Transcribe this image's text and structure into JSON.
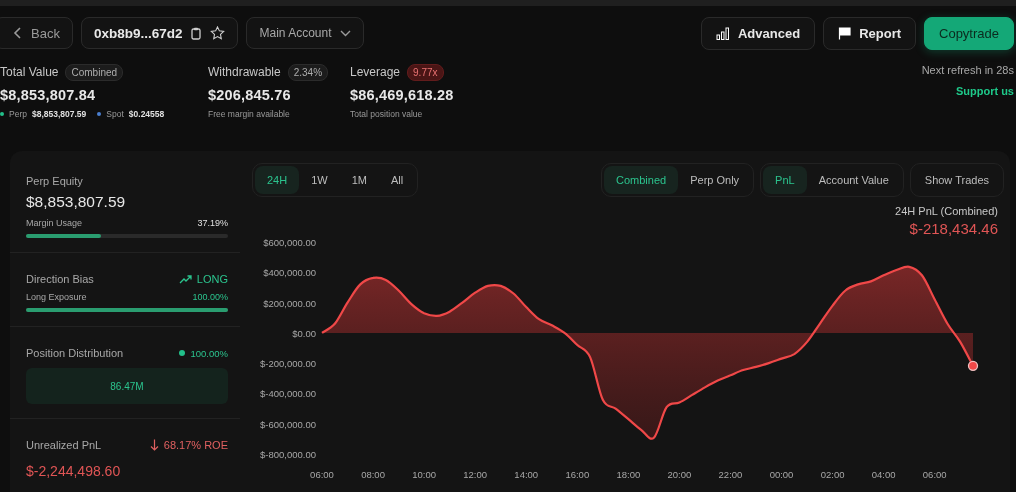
{
  "header": {
    "back_button": "Back",
    "address": "0xb8b9...67d2",
    "account_select": "Main Account",
    "buttons": [
      {
        "label": "Advanced",
        "kind": "advanced"
      },
      {
        "label": "Report",
        "kind": "report"
      },
      {
        "label": "Copytrade",
        "kind": "primary"
      }
    ]
  },
  "stats": [
    {
      "label": "Total Value",
      "badge": "Combined",
      "color": "#1c1c1c",
      "value": "$8,853,807.84",
      "breakdown": [
        {
          "label": "Perp",
          "value": "$8,853,807.59",
          "color": "#22c08a"
        },
        {
          "label": "Spot",
          "value": "$0.24558",
          "color": "#4a7fd0"
        }
      ]
    },
    {
      "label": "Withdrawable",
      "badge": "2.34%",
      "color": "#1c1c1c",
      "value": "$206,845.76",
      "note": "Free margin available"
    },
    {
      "label": "Leverage",
      "badge": "9.77x",
      "color": "#4a1515",
      "value": "$86,469,618.28",
      "note": "Total position value"
    }
  ],
  "refresh": "Next refresh in 28s",
  "support_link": "Support us",
  "panel": {
    "perp_equity": {
      "label": "Perp Equity",
      "value": "$8,853,807.59",
      "meter": {
        "label": "Margin Usage",
        "reading": "37.19%",
        "level": 0.37
      }
    },
    "direction_bias": {
      "label": "Direction Bias",
      "value": "LONG",
      "meter": {
        "label": "Long Exposure",
        "reading": "100.00%",
        "level": 1
      }
    },
    "position_distribution": {
      "label": "Position Distribution",
      "reading": "100.00%",
      "color": "#22c08a",
      "bar_label": "86.47M"
    },
    "unrealized_pnl": {
      "label": "Unrealized PnL",
      "change": "68.17% ROE",
      "value": "$-2,244,498.60"
    }
  },
  "toolbar": {
    "ranges": [
      {
        "label": "24H",
        "selected": true
      },
      {
        "label": "1W",
        "selected": false
      },
      {
        "label": "1M",
        "selected": false
      },
      {
        "label": "All",
        "selected": false
      }
    ],
    "modes": [
      {
        "label": "Combined",
        "selected": true
      },
      {
        "label": "Perp Only",
        "selected": false
      }
    ],
    "metrics": [
      {
        "label": "PnL",
        "selected": true
      },
      {
        "label": "Account Value",
        "selected": false
      }
    ],
    "show_trades": "Show Trades"
  },
  "chart": {
    "title": "24H PnL (Combined)",
    "total": "$-218,434.46",
    "chart_data": {
      "type": "area",
      "categories": [
        "06:00",
        null,
        null,
        null,
        "08:00",
        null,
        null,
        null,
        "10:00",
        null,
        null,
        null,
        "12:00",
        null,
        null,
        null,
        "14:00",
        null,
        null,
        null,
        "16:00",
        null,
        null,
        null,
        "18:00",
        null,
        null,
        null,
        "20:00",
        null,
        null,
        null,
        "22:00",
        null,
        null,
        null,
        "00:00",
        null,
        null,
        null,
        "02:00",
        null,
        null,
        null,
        "04:00",
        null,
        null,
        null,
        "06:00",
        null,
        null,
        null
      ],
      "series": [
        {
          "color": "#f04848",
          "values": [
            0,
            60000,
            200000,
            320000,
            363000,
            350000,
            280000,
            190000,
            130000,
            112000,
            140000,
            200000,
            265000,
            310000,
            310000,
            260000,
            170000,
            90000,
            50000,
            0,
            -80000,
            -160000,
            -442000,
            -500000,
            -570000,
            -640000,
            -693000,
            -490000,
            -460000,
            -410000,
            -360000,
            -315000,
            -280000,
            -245000,
            -225000,
            -200000,
            -170000,
            -140000,
            -60000,
            60000,
            180000,
            280000,
            320000,
            340000,
            380000,
            415000,
            436000,
            380000,
            220000,
            60000,
            -60000,
            -218000
          ]
        }
      ],
      "ylim": [
        -800000,
        600000
      ],
      "yticks": [
        {
          "value": 600000,
          "label": "$600,000.00"
        },
        {
          "value": 400000,
          "label": "$400,000.00"
        },
        {
          "value": 200000,
          "label": "$200,000.00"
        },
        {
          "value": 0,
          "label": "$0.00"
        },
        {
          "value": -200000,
          "label": "$-200,000.00"
        },
        {
          "value": -400000,
          "label": "$-400,000.00"
        },
        {
          "value": -600000,
          "label": "$-600,000.00"
        },
        {
          "value": -800000,
          "label": "$-800,000.00"
        }
      ]
    }
  }
}
